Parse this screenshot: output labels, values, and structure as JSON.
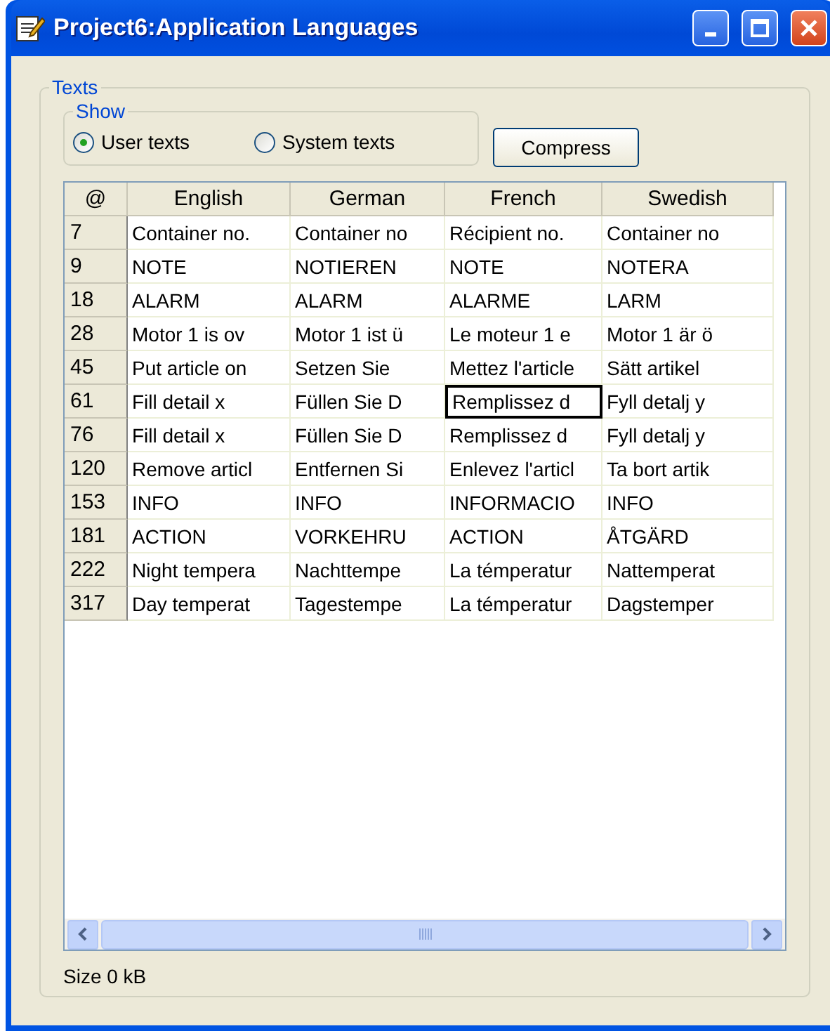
{
  "window": {
    "title": "Project6:Application Languages"
  },
  "texts_group": {
    "label": "Texts",
    "show_group": {
      "label": "Show",
      "options": [
        {
          "label": "User texts",
          "selected": true
        },
        {
          "label": "System texts",
          "selected": false
        }
      ]
    },
    "compress_button": "Compress",
    "table": {
      "corner": "@",
      "columns": [
        "English",
        "German",
        "French",
        "Swedish"
      ],
      "rows": [
        {
          "id": "7",
          "cells": [
            {
              "text": "Container no.",
              "focused": false
            },
            {
              "text": "Container no",
              "focused": false
            },
            {
              "text": "Récipient no.",
              "focused": false
            },
            {
              "text": "Container no",
              "focused": false
            }
          ]
        },
        {
          "id": "9",
          "cells": [
            {
              "text": "NOTE",
              "focused": false
            },
            {
              "text": "NOTIEREN",
              "focused": false
            },
            {
              "text": "NOTE",
              "focused": false
            },
            {
              "text": "NOTERA",
              "focused": false
            }
          ]
        },
        {
          "id": "18",
          "cells": [
            {
              "text": "ALARM",
              "focused": false
            },
            {
              "text": "ALARM",
              "focused": false
            },
            {
              "text": "ALARME",
              "focused": false
            },
            {
              "text": "LARM",
              "focused": false
            }
          ]
        },
        {
          "id": "28",
          "cells": [
            {
              "text": "Motor 1 is ov",
              "focused": false
            },
            {
              "text": "Motor 1 ist ü",
              "focused": false
            },
            {
              "text": "Le moteur 1 e",
              "focused": false
            },
            {
              "text": "Motor 1 är ö",
              "focused": false
            }
          ]
        },
        {
          "id": "45",
          "cells": [
            {
              "text": "Put article on",
              "focused": false
            },
            {
              "text": "Setzen Sie",
              "focused": false
            },
            {
              "text": "Mettez l'article",
              "focused": false
            },
            {
              "text": "Sätt artikel",
              "focused": false
            }
          ]
        },
        {
          "id": "61",
          "cells": [
            {
              "text": "Fill detail x",
              "focused": false
            },
            {
              "text": "Füllen Sie D",
              "focused": false
            },
            {
              "text": "Remplissez d",
              "focused": true
            },
            {
              "text": "Fyll detalj y",
              "focused": false
            }
          ]
        },
        {
          "id": "76",
          "cells": [
            {
              "text": "Fill detail x",
              "focused": false
            },
            {
              "text": "Füllen Sie D",
              "focused": false
            },
            {
              "text": "Remplissez d",
              "focused": false
            },
            {
              "text": "Fyll detalj y",
              "focused": false
            }
          ]
        },
        {
          "id": "120",
          "cells": [
            {
              "text": "Remove articl",
              "focused": false
            },
            {
              "text": "Entfernen Si",
              "focused": false
            },
            {
              "text": "Enlevez l'articl",
              "focused": false
            },
            {
              "text": "Ta bort artik",
              "focused": false
            }
          ]
        },
        {
          "id": "153",
          "cells": [
            {
              "text": "INFO",
              "focused": false
            },
            {
              "text": "INFO",
              "focused": false
            },
            {
              "text": "INFORMACIO",
              "focused": false
            },
            {
              "text": "INFO",
              "focused": false
            }
          ]
        },
        {
          "id": "181",
          "cells": [
            {
              "text": "ACTION",
              "focused": false
            },
            {
              "text": "VORKEHRU",
              "focused": false
            },
            {
              "text": "ACTION",
              "focused": false
            },
            {
              "text": "ÅTGÄRD",
              "focused": false
            }
          ]
        },
        {
          "id": "222",
          "cells": [
            {
              "text": "Night tempera",
              "focused": false
            },
            {
              "text": "Nachttempe",
              "focused": false
            },
            {
              "text": "La témperatur",
              "focused": false
            },
            {
              "text": "Nattemperat",
              "focused": false
            }
          ]
        },
        {
          "id": "317",
          "cells": [
            {
              "text": "Day temperat",
              "focused": false
            },
            {
              "text": "Tagestempe",
              "focused": false
            },
            {
              "text": "La témperatur",
              "focused": false
            },
            {
              "text": "Dagstemper",
              "focused": false
            }
          ]
        }
      ]
    },
    "status": "Size 0 kB"
  }
}
